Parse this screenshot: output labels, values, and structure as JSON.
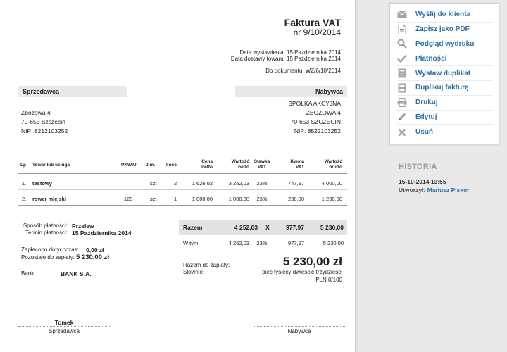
{
  "invoice": {
    "title": "Faktura VAT",
    "number": "nr 9/10/2014",
    "issue_date": "Data wystawienia: 15 Października 2014",
    "delivery_date": "Data dostawy towaru: 15 Października 2014",
    "document_ref": "Do dokumentu: WZ/6/10/2014"
  },
  "seller": {
    "header": "Sprzedawca",
    "street": "Zbożowa 4",
    "city": "70-653 Szczecin",
    "nip": "NIP: 8212103252"
  },
  "buyer": {
    "header": "Nabywca",
    "name": "SPÓŁKA AKCYJNA",
    "street": "ZBOŻOWA 4",
    "city": "70-653 SZCZECIN",
    "nip": "NIP: 8522103252"
  },
  "table": {
    "headers": {
      "lp": "Lp",
      "name": "Towar lub usługa",
      "pkwiu": "PKWiU",
      "unit": "J.m.",
      "qty": "Ilość",
      "price": [
        "Cena",
        "netto"
      ],
      "net_value": [
        "Wartość",
        "netto"
      ],
      "vat_rate": [
        "Stawka",
        "VAT"
      ],
      "vat_amount": [
        "Kwota",
        "VAT"
      ],
      "gross_value": [
        "Wartość",
        "brutto"
      ]
    },
    "rows": [
      {
        "lp": "1.",
        "name": "testowy",
        "pkwiu": "",
        "unit": "szt",
        "qty": "2",
        "price": "1 626,02",
        "net": "3 252,03",
        "rate": "23%",
        "vat": "747,97",
        "gross": "4 000,00"
      },
      {
        "lp": "2.",
        "name": "rower miejski",
        "pkwiu": "123",
        "unit": "szt",
        "qty": "1",
        "price": "1 000,00",
        "net": "1 000,00",
        "rate": "23%",
        "vat": "230,00",
        "gross": "1 230,00"
      }
    ]
  },
  "payment": {
    "method_label": "Sposób płatności:",
    "method": "Przelew",
    "due_label": "Termin płatności:",
    "due": "15 Października 2014",
    "paid_label": "Zapłacono dotychczas:",
    "paid": "0,00 zł",
    "remaining_label": "Pozostało do zapłaty:",
    "remaining": "5 230,00 zł",
    "bank_label": "Bank:",
    "bank": "BANK S.A."
  },
  "summary": {
    "total_label": "Razem",
    "total_net": "4 252,03",
    "total_rate": "X",
    "total_vat": "977,97",
    "total_gross": "5 230,00",
    "incl_label": "W tym",
    "incl_net": "4 252,03",
    "incl_rate": "23%",
    "incl_vat": "977,97",
    "incl_gross": "5 230,00",
    "to_pay_label": "Razem do zapłaty:",
    "to_pay": "5 230,00 zł",
    "words_label": "Słownie:",
    "words_line1": "pięć tysięcy dwieście trzydzieści",
    "words_line2": "PLN 0/100"
  },
  "signatures": {
    "seller_name": "Tomek",
    "seller_role": "Sprzedawca",
    "buyer_role": "Nabywca"
  },
  "actions": [
    {
      "label": "Wyślij do klienta",
      "icon": "envelope-icon"
    },
    {
      "label": "Zapisz jako PDF",
      "icon": "pdf-file-icon"
    },
    {
      "label": "Podgląd wydruku",
      "icon": "magnifier-icon"
    },
    {
      "label": "Płatności",
      "icon": "checkmark-icon"
    },
    {
      "label": "Wystaw duplikat",
      "icon": "document-copy-icon"
    },
    {
      "label": "Duplikuj fakturę",
      "icon": "duplicate-icon"
    },
    {
      "label": "Drukuj",
      "icon": "printer-icon"
    },
    {
      "label": "Edytuj",
      "icon": "pencil-icon"
    },
    {
      "label": "Usuń",
      "icon": "delete-x-icon"
    }
  ],
  "history": {
    "title": "HISTORIA",
    "date": "15-10-2014 13:55",
    "created_label": "Utworzył:",
    "created_by": "Mariusz Piskor"
  },
  "colors": {
    "link": "#2f6ea4",
    "icon_gray": "#9a9a9a",
    "header_bg": "#e9e9e9"
  }
}
